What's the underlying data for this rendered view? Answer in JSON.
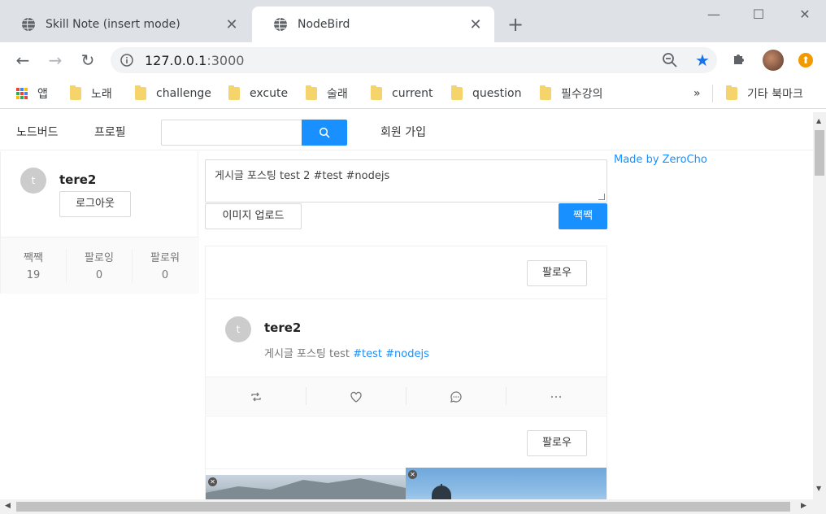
{
  "browser": {
    "tabs": [
      {
        "title": "Skill Note (insert mode)",
        "close": "✕"
      },
      {
        "title": "NodeBird",
        "close": "✕"
      }
    ],
    "new_tab": "+",
    "window_controls": {
      "minimize": "—",
      "maximize": "☐",
      "close": "✕"
    },
    "nav": {
      "back": "←",
      "forward": "→",
      "reload": "↻"
    },
    "address": {
      "host": "127.0.0.1",
      "port": ":3000"
    },
    "bookmarks": [
      {
        "label": "앱",
        "type": "apps"
      },
      {
        "label": "노래",
        "type": "folder"
      },
      {
        "label": "challenge",
        "type": "folder"
      },
      {
        "label": "excute",
        "type": "folder"
      },
      {
        "label": "술래",
        "type": "folder"
      },
      {
        "label": "current",
        "type": "folder"
      },
      {
        "label": "question",
        "type": "folder"
      },
      {
        "label": "필수강의",
        "type": "folder"
      }
    ],
    "bookmarks_overflow": "»",
    "other_bookmarks": "기타 북마크"
  },
  "app": {
    "menu": {
      "home": "노드버드",
      "profile": "프로필",
      "signup": "회원 가입"
    },
    "search": {
      "placeholder": ""
    },
    "user": {
      "avatar_letter": "t",
      "nickname": "tere2",
      "logout_label": "로그아웃",
      "stats": [
        {
          "label": "짹짹",
          "value": "19"
        },
        {
          "label": "팔로잉",
          "value": "0"
        },
        {
          "label": "팔로워",
          "value": "0"
        }
      ]
    },
    "post_form": {
      "text": "게시글 포스팅 test 2 #test #nodejs",
      "upload_label": "이미지 업로드",
      "submit_label": "짹짹"
    },
    "posts": [
      {
        "follow_label": "팔로우",
        "avatar_letter": "t",
        "author": "tere2",
        "text": "게시글 포스팅 test ",
        "tags": [
          "#test",
          "#nodejs"
        ]
      },
      {
        "follow_label": "팔로우"
      }
    ],
    "made_by": "Made by ZeroCho",
    "accent_color": "#1890ff"
  }
}
